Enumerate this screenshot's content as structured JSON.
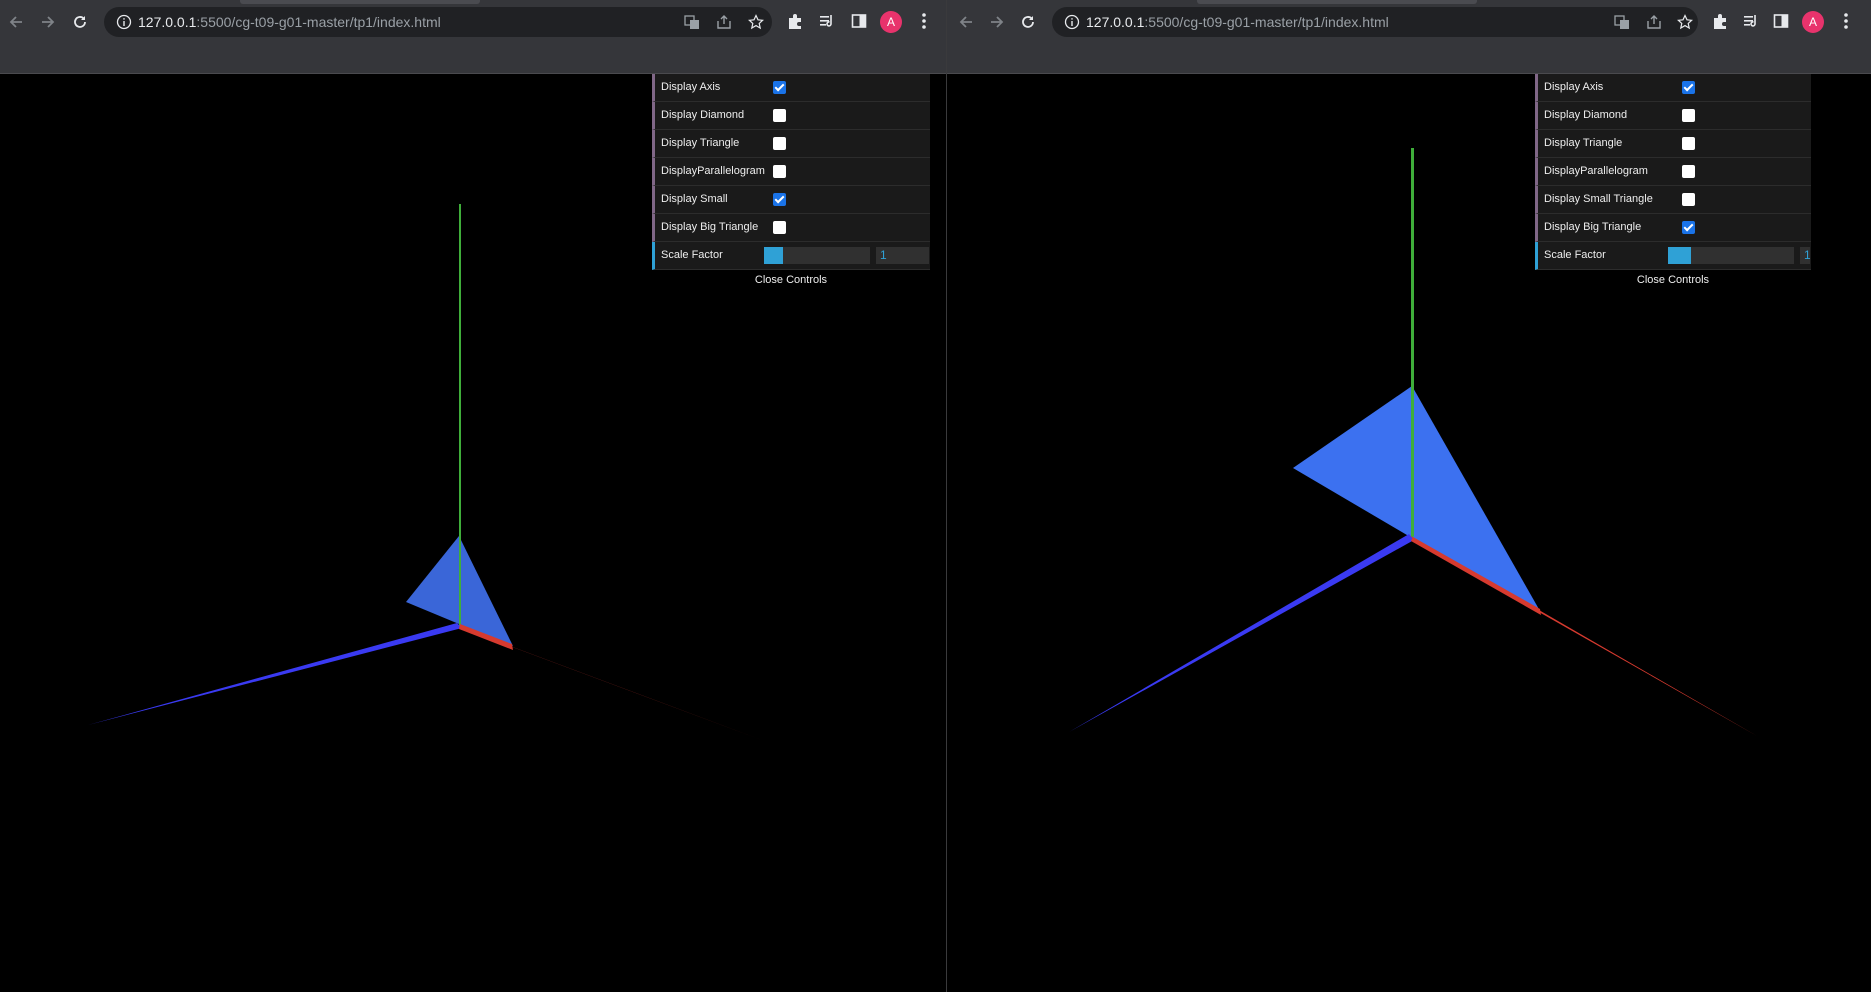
{
  "browser": {
    "url_host": "127.0.0.1",
    "url_path": ":5500/cg-t09-g01-master/tp1/index.html",
    "avatar_letter": "A",
    "icons": [
      "back-icon",
      "forward-icon",
      "reload-icon",
      "info-icon",
      "translate-icon",
      "share-icon",
      "star-icon",
      "extensions-icon",
      "media-icon",
      "side-panel-icon",
      "more-icon"
    ]
  },
  "left_gui": {
    "controls": [
      {
        "label": "Display Axis",
        "checked": true
      },
      {
        "label": "Display Diamond",
        "checked": false
      },
      {
        "label": "Display Triangle",
        "checked": false
      },
      {
        "label": "DisplayParallelogram",
        "checked": false
      },
      {
        "label": "Display Small",
        "checked": true
      },
      {
        "label": "Display Big Triangle",
        "checked": false
      }
    ],
    "scale_label": "Scale Factor",
    "scale_value": "1",
    "scale_fraction": 0.18,
    "close_label": "Close Controls"
  },
  "right_gui": {
    "controls": [
      {
        "label": "Display Axis",
        "checked": true
      },
      {
        "label": "Display Diamond",
        "checked": false
      },
      {
        "label": "Display Triangle",
        "checked": false
      },
      {
        "label": "DisplayParallelogram",
        "checked": false
      },
      {
        "label": "Display Small Triangle",
        "checked": false
      },
      {
        "label": "Display Big Triangle",
        "checked": true
      }
    ],
    "scale_label": "Scale Factor",
    "scale_value": "1",
    "scale_fraction": 0.18,
    "close_label": "Close Controls"
  },
  "colors": {
    "x_axis": "#d63a2f",
    "y_axis": "#3fae3a",
    "z_axis": "#3a3af2",
    "shape": "#3f6fe6",
    "checkbox_on": "#1a73e8",
    "slider": "#2fa1d6",
    "toolbar": "#35363a",
    "avatar": "#e8336c"
  }
}
